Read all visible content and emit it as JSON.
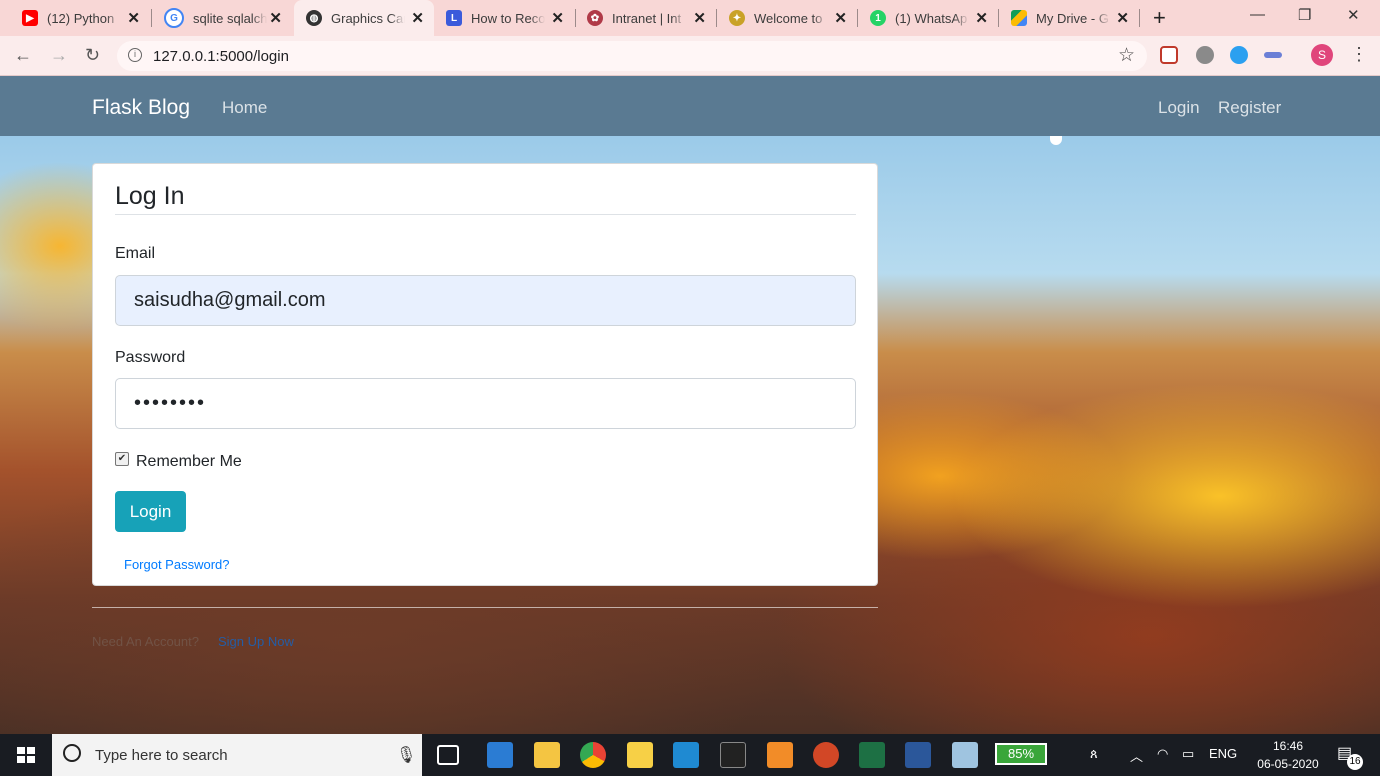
{
  "browser": {
    "tabs": [
      {
        "title": "(12) Python",
        "favicon": "youtube-icon",
        "color": "#ff0000"
      },
      {
        "title": "sqlite sqlalch",
        "favicon": "google-icon",
        "color": "#4285f4"
      },
      {
        "title": "Graphics Car",
        "favicon": "globe-icon",
        "color": "#333333"
      },
      {
        "title": "How to Reco",
        "favicon": "l-app-icon",
        "color": "#3b5bdb"
      },
      {
        "title": "Intranet | Int",
        "favicon": "intranet-icon",
        "color": "#b03a48"
      },
      {
        "title": "Welcome to",
        "favicon": "welcome-icon",
        "color": "#c9a227"
      },
      {
        "title": "(1) WhatsAp",
        "favicon": "whatsapp-icon",
        "color": "#25d366"
      },
      {
        "title": "My Drive - G",
        "favicon": "google-drive-icon",
        "color": "#fbbc04"
      }
    ],
    "active_tab_index": 2,
    "url": "127.0.0.1:5000/login",
    "profile_initial": "S"
  },
  "site": {
    "brand": "Flask Blog",
    "nav_left": [
      "Home"
    ],
    "nav_right": [
      "Login",
      "Register"
    ]
  },
  "login_form": {
    "legend": "Log In",
    "email_label": "Email",
    "email_value": "saisudha@gmail.com",
    "password_label": "Password",
    "password_value": "••••••••",
    "remember_label": "Remember Me",
    "remember_checked": true,
    "submit_label": "Login",
    "forgot_link": "Forgot Password?"
  },
  "below_form": {
    "text": "Need An Account?",
    "link": "Sign Up Now"
  },
  "taskbar": {
    "search_placeholder": "Type here to search",
    "battery": "85%",
    "language": "ENG",
    "time": "16:46",
    "date": "06-05-2020",
    "notifications": "16"
  },
  "colors": {
    "navbar": "#5a7a92",
    "button": "#17a2b8",
    "link": "#007bff"
  }
}
